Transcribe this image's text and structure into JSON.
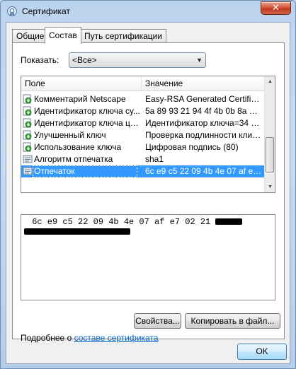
{
  "window": {
    "title": "Сертификат",
    "close_label": "✕"
  },
  "tabs": [
    {
      "label": "Общие"
    },
    {
      "label": "Состав"
    },
    {
      "label": "Путь сертификации"
    }
  ],
  "filter": {
    "label": "Показать:",
    "value": "<Все>"
  },
  "list": {
    "columns": [
      "Поле",
      "Значение"
    ],
    "rows": [
      {
        "field": "Комментарий Netscape",
        "value": "Easy-RSA Generated Certificate",
        "icon": "extension-icon"
      },
      {
        "field": "Идентификатор ключа су...",
        "value": "5a 89 93 21 94 4f 4b 0b 8a 64...",
        "icon": "extension-icon"
      },
      {
        "field": "Идентификатор ключа це...",
        "value": "Идентификатор ключа=34 b...",
        "icon": "extension-icon"
      },
      {
        "field": "Улучшенный ключ",
        "value": "Проверка подлинности клие...",
        "icon": "extension-icon"
      },
      {
        "field": "Использование ключа",
        "value": "Цифровая подпись (80)",
        "icon": "extension-icon"
      },
      {
        "field": "Алгоритм отпечатка",
        "value": "sha1",
        "icon": "property-icon"
      },
      {
        "field": "Отпечаток",
        "value": "6c e9 c5 22 09 4b 4e 07 af e7 ...",
        "icon": "property-icon",
        "selected": true
      }
    ]
  },
  "value_box": {
    "line1": " 6c e9 c5 22 09 4b 4e 07 af e7 02 21 "
  },
  "buttons": {
    "properties": "Свойства...",
    "copy_to_file": "Копировать в файл...",
    "ok": "OK"
  },
  "details": {
    "prefix": "Подробнее о ",
    "link": "составе сертификата"
  },
  "colors": {
    "selection": "#3399ff",
    "link": "#0066cc"
  }
}
